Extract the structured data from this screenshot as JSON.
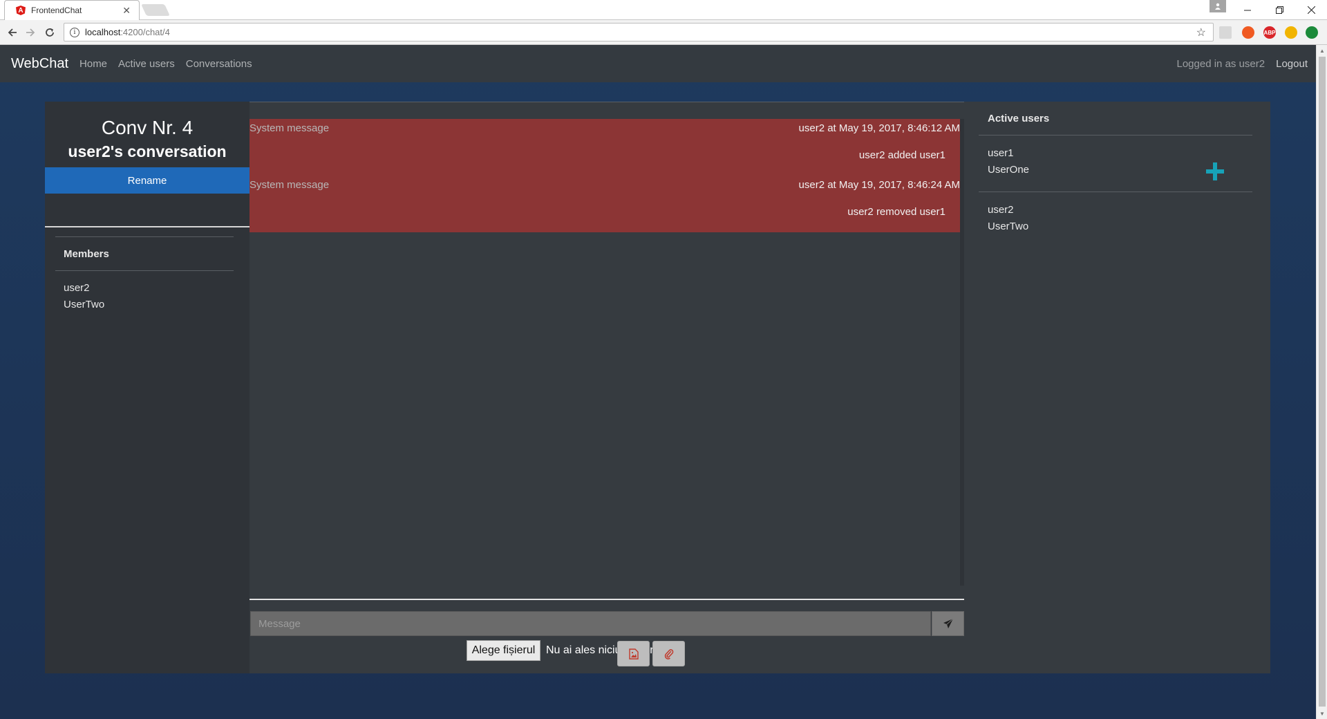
{
  "browser": {
    "tab_title": "FrontendChat",
    "url_host": "localhost",
    "url_path": ":4200/chat/4",
    "extensions": [
      {
        "name": "adblock-icon",
        "label": "ABP",
        "color": "#d9262b"
      },
      {
        "name": "extension-orange-icon",
        "label": "",
        "color": "#f05a22"
      },
      {
        "name": "extension-moon-icon",
        "label": "",
        "color": "#f1b400"
      },
      {
        "name": "extension-green-icon",
        "label": "",
        "color": "#1b8a3a"
      }
    ]
  },
  "navbar": {
    "brand": "WebChat",
    "links": [
      "Home",
      "Active users",
      "Conversations"
    ],
    "logged_in": "Logged in as user2",
    "logout": "Logout"
  },
  "conversation": {
    "title": "Conv Nr. 4",
    "subtitle": "user2's conversation",
    "rename_label": "Rename"
  },
  "members": {
    "heading": "Members",
    "items": [
      {
        "username": "user2",
        "display_name": "UserTwo"
      }
    ]
  },
  "messages": [
    {
      "sender": "System message",
      "meta": "user2 at May 19, 2017, 8:46:12 AM",
      "text": "user2 added user1"
    },
    {
      "sender": "System message",
      "meta": "user2 at May 19, 2017, 8:46:24 AM",
      "text": "user2 removed user1"
    }
  ],
  "composer": {
    "placeholder": "Message",
    "file_button": "Alege fișierul",
    "file_status": "Nu ai ales niciun fișier"
  },
  "active_users": {
    "heading": "Active users",
    "items": [
      {
        "username": "user1",
        "display_name": "UserOne"
      },
      {
        "username": "user2",
        "display_name": "UserTwo"
      }
    ]
  },
  "colors": {
    "navbar": "#343a40",
    "rename_button": "#1f69b8",
    "system_message": "#8c3535",
    "add_icon": "#17a2b8"
  }
}
